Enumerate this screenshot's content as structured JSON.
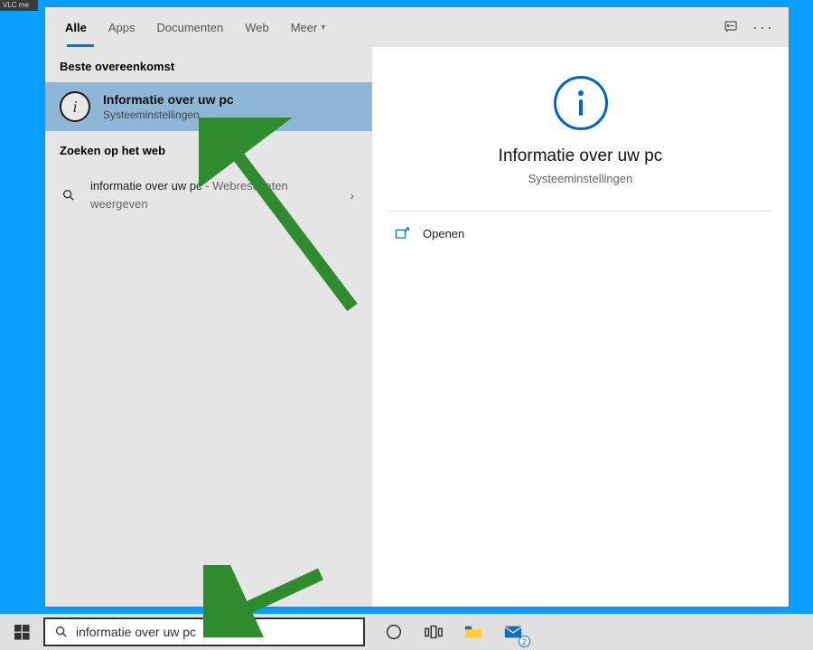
{
  "colors": {
    "accent": "#0078d4",
    "arrow": "#2e8b2e"
  },
  "top_window": {
    "title": "VLC me"
  },
  "tabs": {
    "items": [
      "Alle",
      "Apps",
      "Documenten",
      "Web",
      "Meer"
    ],
    "active_index": 0
  },
  "left": {
    "best_match_header": "Beste overeenkomst",
    "best_match": {
      "title": "Informatie over uw pc",
      "subtitle": "Systeeminstellingen"
    },
    "web_header": "Zoeken op het web",
    "web_result": {
      "prefix": "informatie over uw pc",
      "suffix": " - Webresultaten weergeven"
    }
  },
  "detail": {
    "title": "Informatie over uw pc",
    "subtitle": "Systeeminstellingen",
    "open_label": "Openen"
  },
  "taskbar": {
    "search_value": "informatie over uw pc",
    "mail_badge": "2"
  }
}
